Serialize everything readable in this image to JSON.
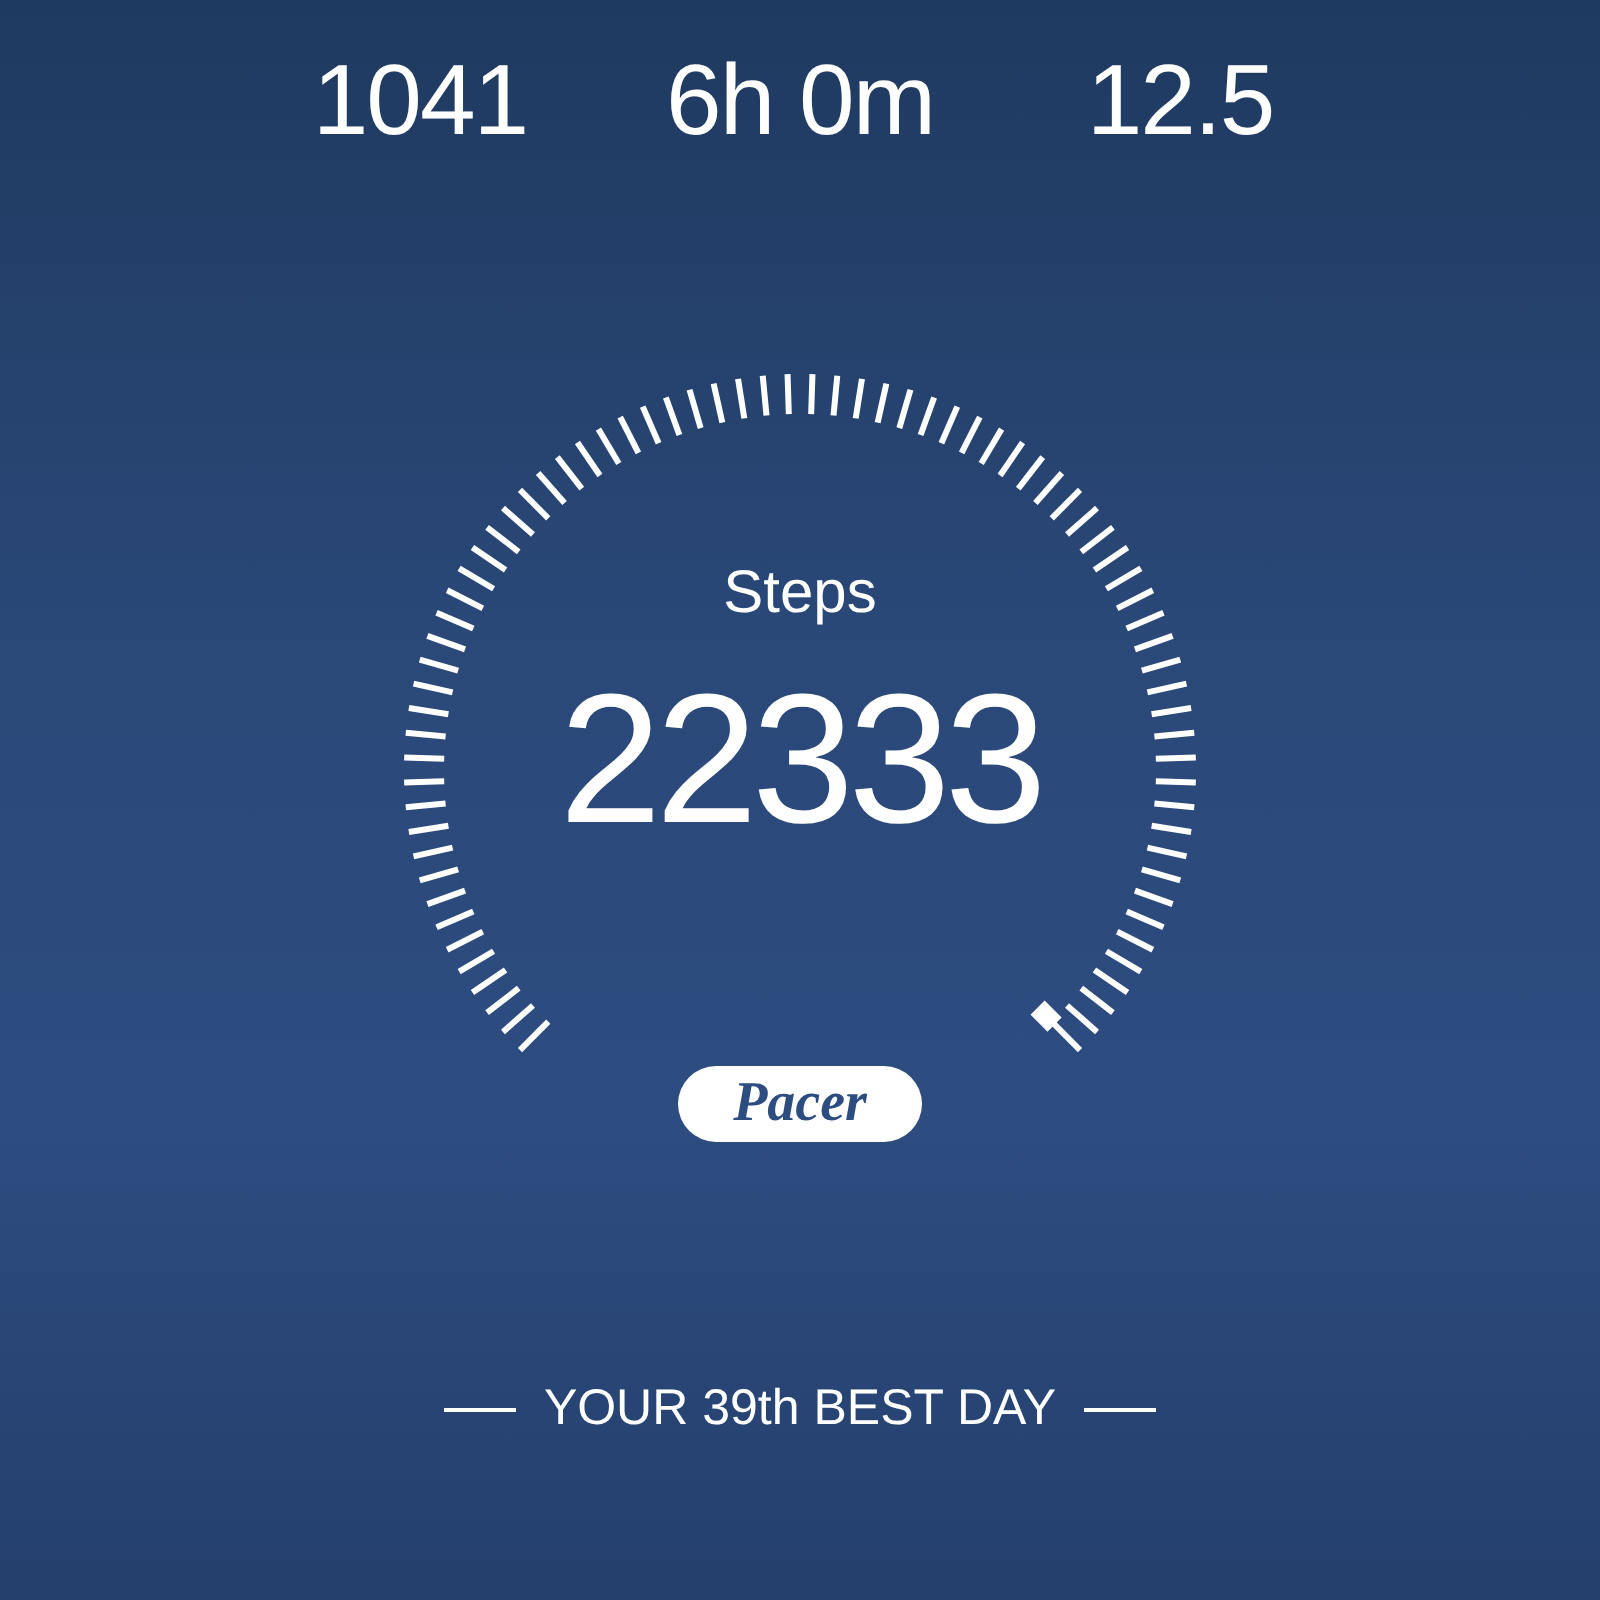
{
  "stats": [
    {
      "value": "1041"
    },
    {
      "value": "6h 0m"
    },
    {
      "value": "12.5"
    }
  ],
  "gauge": {
    "label": "Steps",
    "value": "22333"
  },
  "badge": "Pacer",
  "footer": "YOUR 39th BEST DAY"
}
